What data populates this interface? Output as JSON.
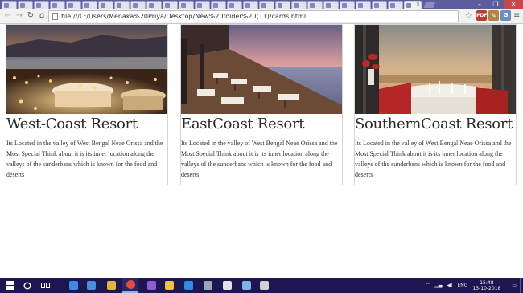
{
  "browser": {
    "tab_count_icons": 26,
    "active_tab_close": "×",
    "window_controls": {
      "minimize": "–",
      "maximize": "❐",
      "close": "✕"
    },
    "nav": {
      "back": "←",
      "forward": "→",
      "reload": "↻",
      "home": "⌂"
    },
    "url": "file:///C:/Users/Menaka%20Priya/Desktop/New%20folder%20(11)/cards.html",
    "toolbar_icons": [
      "star-icon",
      "pdf-extension-icon",
      "note-extension-icon",
      "globe-extension-icon",
      "menu-icon"
    ],
    "star_glyph": "☆",
    "ext1_label": "PDF",
    "ext2_label": "✎",
    "ext3_label": "G",
    "menu_glyph": "≡"
  },
  "cards": [
    {
      "title": "West-Coast Resort",
      "text": "Its Located in the valley of West Bengal Neae Orissa and the Most Special Think about it is its inner location along the valleys of the sunderbans which is known for the food and deserts"
    },
    {
      "title": "EastCoast Resort",
      "text": "Its Located in the valley of West Bengal Neae Orissa and the Most Special Think about it is its inner location along the valleys of the sunderbans which is known for the food and deserts"
    },
    {
      "title": "SouthernCoast Resort",
      "text": "Its Located in the valley of West Bengal Neae Orissa and the Most Special Think about it is its inner location along the valleys of the sunderbans which is known for the food and deserts"
    }
  ],
  "taskbar": {
    "apps": [
      "edge-icon",
      "store-icon",
      "file-explorer-icon",
      "chrome-icon",
      "visual-studio-icon",
      "folder-icon",
      "vscode-icon",
      "photos-icon",
      "mail-icon",
      "notepad-icon",
      "image-viewer-icon"
    ],
    "lang": "ENG",
    "time": "15:48",
    "date": "13-10-2018"
  },
  "colors": {
    "tabstrip": "#5c5d9f",
    "toolbar": "#f2f2f2",
    "taskbar": "#1e1650",
    "close_button": "#c74848"
  }
}
